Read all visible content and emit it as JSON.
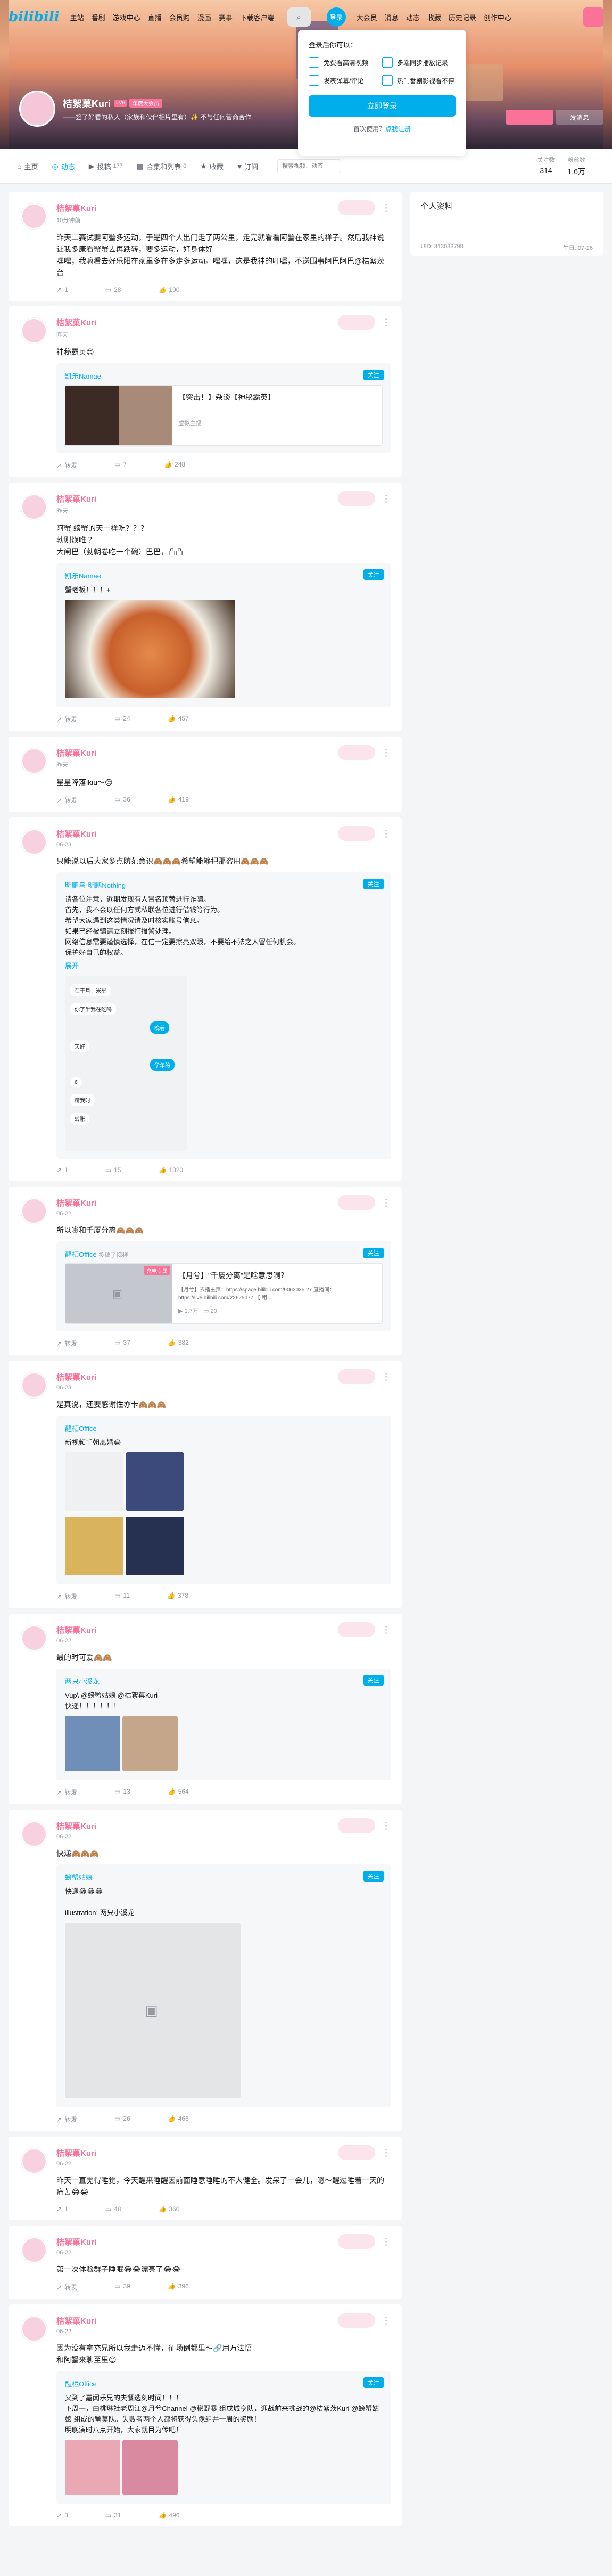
{
  "nav": {
    "logo": "bilibili",
    "links": [
      "主站",
      "番剧",
      "游戏中心",
      "直播",
      "会员购",
      "漫画",
      "赛事"
    ],
    "download": "下载客户端",
    "search_icon": "search-icon",
    "login": "登录",
    "right_links": [
      "大会员",
      "消息",
      "动态",
      "收藏",
      "历史记录",
      "创作中心"
    ]
  },
  "popup": {
    "title": "登录后你可以：",
    "features": [
      "免费看高清视频",
      "多端同步播放记录",
      "发表弹幕/评论",
      "热门番剧影视看不停"
    ],
    "button": "立即登录",
    "footer_prefix": "首次使用？",
    "footer_link": "点我注册"
  },
  "profile": {
    "name": "桔絮菓Kuri",
    "level": "LV6",
    "vip": "年度大会员",
    "sign": "——签了好看的私人（家族和伙伴相片里有）✨ 不与任何营商合作",
    "send_message": "发消息"
  },
  "tabs": [
    {
      "icon": "home-icon",
      "label": "主页",
      "count": ""
    },
    {
      "icon": "dynamic-icon",
      "label": "动态",
      "count": ""
    },
    {
      "icon": "video-icon",
      "label": "投稿",
      "count": "177"
    },
    {
      "icon": "collection-icon",
      "label": "合集和列表",
      "count": "0"
    },
    {
      "icon": "favorite-icon",
      "label": "收藏",
      "count": ""
    },
    {
      "icon": "subscribe-icon",
      "label": "订阅",
      "count": ""
    }
  ],
  "tab_search_placeholder": "搜索视频、动态",
  "stats": [
    {
      "label": "关注数",
      "value": "314"
    },
    {
      "label": "粉丝数",
      "value": "1.6万"
    }
  ],
  "side": {
    "title": "个人资料",
    "uid": "UID: 313033798",
    "birthday": "生日: 07-26"
  },
  "posts": [
    {
      "author": "桔絮菓Kuri",
      "time": "10分钟前",
      "text": "昨天二赛试要阿蟹多运动，于是四个人出门走了两公里，走完就看看阿蟹在家里的样子。然后我神说让我多康看蟹蟹去再跌转，要多运动，好身体好\n嘿嘿，我嘛看去好乐阳在家里多在多走多运动。嘿嘿，这是我神的叮嘱，不送围事阿巴阿巴@桔絮茨台",
      "repost": "1",
      "comment": "28",
      "like": "190"
    },
    {
      "author": "桔絮菓Kuri",
      "time": "昨天",
      "text": "神秘霸英😊",
      "ref_author": "凯乐Namae",
      "ref_video_title": "【突击！】杂谈【神秘霸英】",
      "ref_video_meta": "虚拟主播",
      "repost": "转发",
      "comment": "7",
      "like": "248"
    },
    {
      "author": "桔絮菓Kuri",
      "time": "昨天",
      "text": "阿蟹 螃蟹的天一样吃？？？\n勃则焕唯 ？\n大闸巴（勃朝卷吃一个碗）巴巴，凸凸",
      "ref_author": "凯乐Namae",
      "ref_text": "蟹老板！！！+",
      "repost": "转发",
      "comment": "24",
      "like": "457"
    },
    {
      "author": "桔絮菓Kuri",
      "time": "昨天",
      "text": "星星降落ikiu～😊",
      "repost": "转发",
      "comment": "36",
      "like": "419"
    },
    {
      "author": "桔絮菓Kuri",
      "time": "06-23",
      "text": "只能说以后大家多点防范意识🙈🙈🙈希望能够把那盗用🙈🙈🙈",
      "ref_author": "明鹏鸟-明鹏Nothing",
      "ref_text": "请各位注意，近期发现有人冒名顶替进行诈骗。\n首先，我不会以任何方式私联各位进行借钱等行为。\n希望大家遇到这类情况请及时核实账号信息。\n如果已经被骗请立刻报打报警处理。\n网络信息需要谨慎选择，在信一定要擦亮双眼，不要给不法之人留任何机会。\n保护好自己的权益。",
      "ref_more": "展开",
      "chat": [
        "在于月，米星",
        "你了半我在吃吗",
        "晚着",
        "天好",
        "学年的",
        "6",
        "精我时",
        "转账"
      ],
      "repost": "1",
      "comment": "15",
      "like": "1820"
    },
    {
      "author": "桔絮菓Kuri",
      "time": "06-22",
      "text": "所以嗡和千厦分离🙈🙈🙈",
      "ref_author": "醒栖Office",
      "ref_sub": "投稿了视频",
      "ref_video_title": "【月兮】\"千厦分离\"是啥意思啊？",
      "ref_video_desc": "【月兮】去播主页：https://space.bilibili.com/9062035 27 直播间：https://live.bilibili.com/22625077 【·租...",
      "ref_video_meta_views": "1.7万",
      "ref_video_meta_danmaku": "20",
      "badge": "充电专属",
      "repost": "转发",
      "comment": "37",
      "like": "382"
    },
    {
      "author": "桔絮菓Kuri",
      "time": "06-23",
      "text": "是真说，还要感谢性亦卡🙈🙈🙈",
      "ref_author": "醒栖Office",
      "ref_text": "新视频千朝离婚😂",
      "repost": "转发",
      "comment": "11",
      "like": "378"
    },
    {
      "author": "桔絮菓Kuri",
      "time": "06-22",
      "text": "最的时可爱🙈🙈",
      "ref_author": "两只小溪龙",
      "ref_text": "Vup\\ @螃蟹姑娘 @桔絮菓Kuri\n快递！！！！！！",
      "repost": "转发",
      "comment": "13",
      "like": "564"
    },
    {
      "author": "桔絮菓Kuri",
      "time": "06-22",
      "text": "快递🙈🙈🙈",
      "ref_author": "螃蟹姑娘",
      "ref_text": "快递😂😂😂\n\nillustration: 两只小溪龙",
      "repost": "转发",
      "comment": "26",
      "like": "466"
    },
    {
      "author": "桔絮菓Kuri",
      "time": "06-22",
      "text": "昨天一直觉得睡觉，今天醒来睡醒因前面睡意睡睡的不大健全。发呆了一会儿，嗯～醒过睡着一天的痛苦😂😂",
      "repost": "1",
      "comment": "48",
      "like": "360"
    },
    {
      "author": "桔絮菓Kuri",
      "time": "06-22",
      "text": "第一次体验群子睡眠😂😂漂亮了😂😂",
      "repost": "转发",
      "comment": "39",
      "like": "396"
    },
    {
      "author": "桔絮菓Kuri",
      "time": "06-22",
      "text": "因为没有拿充兄所以我走迈不懂，征场倒都里～🔗用万法悟\n和阿蟹来聊至里😊",
      "ref_author": "醒栖Office",
      "ref_text": "又到了嘉闻乐兄的夫餐选刻时间！！！\n下周一，由桃琳社老周江@月兮Channel @秘野暴 组成城亨队，迎战前来挑战的@桔絮茨Kuri @螃蟹姑娘 组成的蟹莫队。失败者两个人都将获得头像组并一周的奖励！\n明晚演时八点开始，大家就目为传吧！",
      "repost": "3",
      "comment": "31",
      "like": "496"
    }
  ]
}
